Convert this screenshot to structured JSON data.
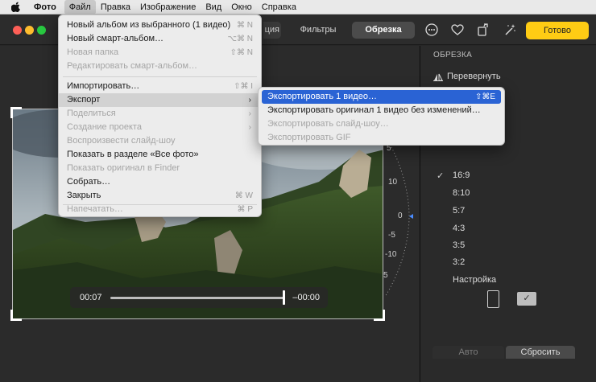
{
  "menubar": {
    "app_name": "Фото",
    "items": [
      "Файл",
      "Правка",
      "Изображение",
      "Вид",
      "Окно",
      "Справка"
    ]
  },
  "toolbar": {
    "tab_partial": "ция",
    "tab_filters": "Фильтры",
    "tab_crop": "Обрезка",
    "done_label": "Готово",
    "icons": [
      "more-icon",
      "heart-icon",
      "rotate-icon",
      "magic-wand-icon"
    ]
  },
  "file_menu": {
    "items": [
      {
        "label": "Новый альбом из выбранного (1 видео)",
        "shortcut": "⌘ N",
        "disabled": false
      },
      {
        "label": "Новый смарт-альбом…",
        "shortcut": "⌥⌘ N",
        "disabled": false
      },
      {
        "label": "Новая папка",
        "shortcut": "⇧⌘ N",
        "disabled": true
      },
      {
        "label": "Редактировать смарт-альбом…",
        "shortcut": "",
        "disabled": true
      },
      {
        "label": "Импортировать…",
        "shortcut": "⇧⌘ I",
        "disabled": false
      },
      {
        "label": "Экспорт",
        "shortcut": "",
        "disabled": false,
        "submenu": true
      },
      {
        "label": "Поделиться",
        "shortcut": "",
        "disabled": true,
        "submenu": true
      },
      {
        "label": "Создание проекта",
        "shortcut": "",
        "disabled": true,
        "submenu": true
      },
      {
        "label": "Воспроизвести слайд-шоу",
        "shortcut": "",
        "disabled": true
      },
      {
        "label": "Показать в разделе «Все фото»",
        "shortcut": "",
        "disabled": false
      },
      {
        "label": "Показать оригинал в Finder",
        "shortcut": "",
        "disabled": true
      },
      {
        "label": "Собрать…",
        "shortcut": "",
        "disabled": false
      },
      {
        "label": "Закрыть",
        "shortcut": "⌘ W",
        "disabled": false
      },
      {
        "label": "Напечатать…",
        "shortcut": "⌘ P",
        "disabled": true
      }
    ]
  },
  "export_submenu": {
    "items": [
      {
        "label": "Экспортировать 1 видео…",
        "shortcut": "⇧⌘E",
        "disabled": false
      },
      {
        "label": "Экспортировать оригинал 1 видео без изменений…",
        "shortcut": "",
        "disabled": false
      },
      {
        "label": "Экспортировать слайд-шоу…",
        "shortcut": "",
        "disabled": true
      },
      {
        "label": "Экспортировать GIF",
        "shortcut": "",
        "disabled": true
      }
    ]
  },
  "player": {
    "current_time": "00:07",
    "remaining_time": "–00:00",
    "progress": 1.0
  },
  "dial": {
    "labels": [
      "5",
      "10",
      "0",
      "-5",
      "-10",
      "5"
    ]
  },
  "sidebar": {
    "title": "ОБРЕЗКА",
    "flip_label": "Перевернуть",
    "aspect_ratios": [
      "16:9",
      "8:10",
      "5:7",
      "4:3",
      "3:5",
      "3:2",
      "Настройка"
    ],
    "selected_aspect": "16:9",
    "checkmark": "✓",
    "auto_label": "Авто",
    "reset_label": "Сбросить"
  },
  "colors": {
    "accent_done": "#ffcc14",
    "menu_highlight": "#2a63d4"
  }
}
